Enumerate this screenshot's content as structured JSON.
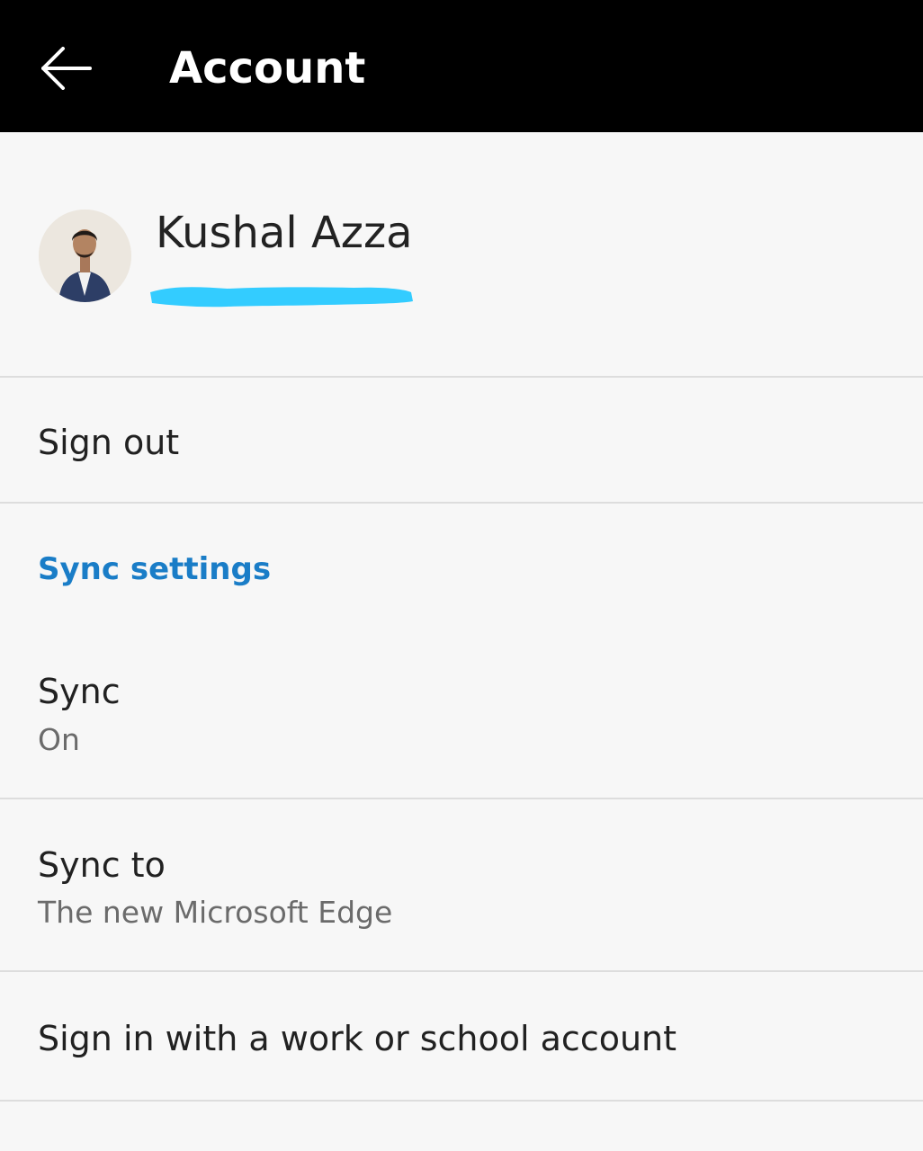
{
  "header": {
    "title": "Account",
    "back_icon": "arrow-left-icon",
    "background": "#000000"
  },
  "profile": {
    "name": "Kushal Azza",
    "email_redaction_color": "#33ccff"
  },
  "items": {
    "sign_out": "Sign out",
    "sync_section": "Sync settings",
    "sync": {
      "title": "Sync",
      "value": "On"
    },
    "sync_to": {
      "title": "Sync to",
      "value": "The new Microsoft Edge"
    },
    "work_signin": "Sign in with a work or school account"
  },
  "colors": {
    "accent": "#1a7dc7",
    "background": "#f7f7f7",
    "divider": "#dddddd"
  }
}
